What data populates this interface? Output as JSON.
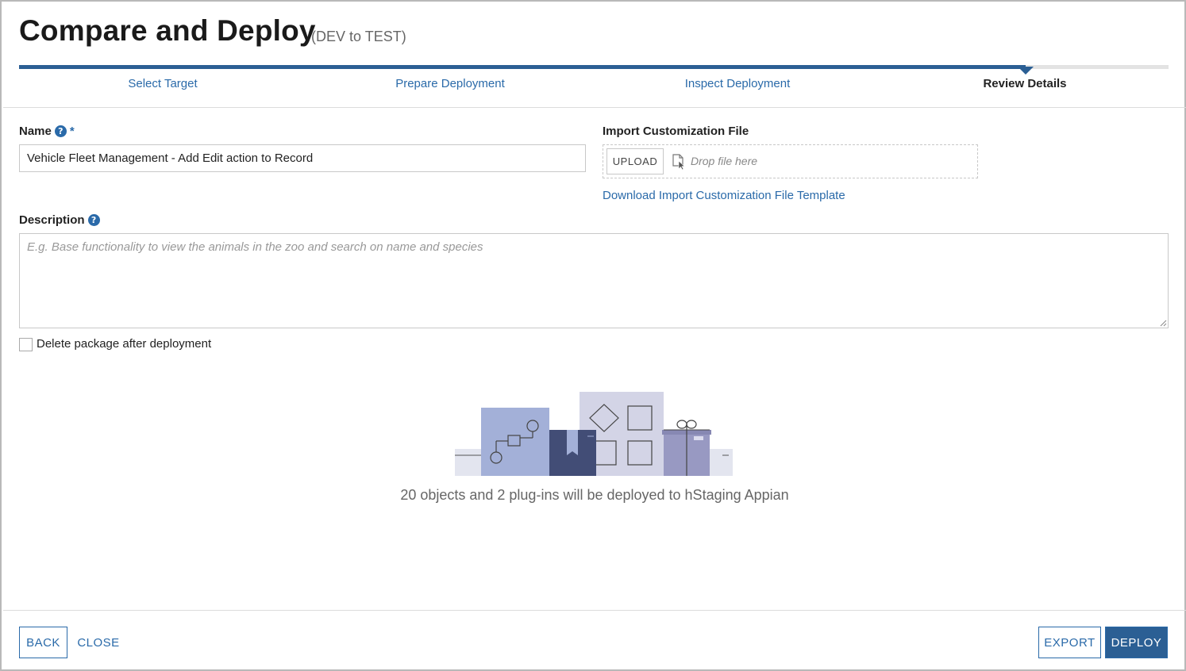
{
  "header": {
    "title": "Compare and Deploy",
    "subtitle": "(DEV to TEST)"
  },
  "steps": [
    {
      "label": "Select Target",
      "state": "complete"
    },
    {
      "label": "Prepare Deployment",
      "state": "complete"
    },
    {
      "label": "Inspect Deployment",
      "state": "complete"
    },
    {
      "label": "Review Details",
      "state": "current"
    }
  ],
  "form": {
    "name_label": "Name",
    "required_mark": "*",
    "name_value": "Vehicle Fleet Management - Add Edit action to Record",
    "import_label": "Import Customization File",
    "upload_label": "UPLOAD",
    "drop_text": "Drop file here",
    "template_link": "Download Import Customization File Template",
    "description_label": "Description",
    "description_placeholder": "E.g. Base functionality to view the animals in the zoo and search on name and species",
    "description_value": "",
    "delete_label": "Delete package after deployment",
    "delete_checked": false,
    "help_icon": "question-circle-icon"
  },
  "summary": "20 objects and 2 plug-ins will be deployed to hStaging Appian",
  "footer": {
    "back_label": "BACK",
    "close_label": "CLOSE",
    "export_label": "EXPORT",
    "deploy_label": "DEPLOY"
  },
  "colors": {
    "accent": "#2a6aa9",
    "primary_button": "#2b5f94",
    "title_text": "#1a1a1a",
    "muted_text": "#666666"
  }
}
